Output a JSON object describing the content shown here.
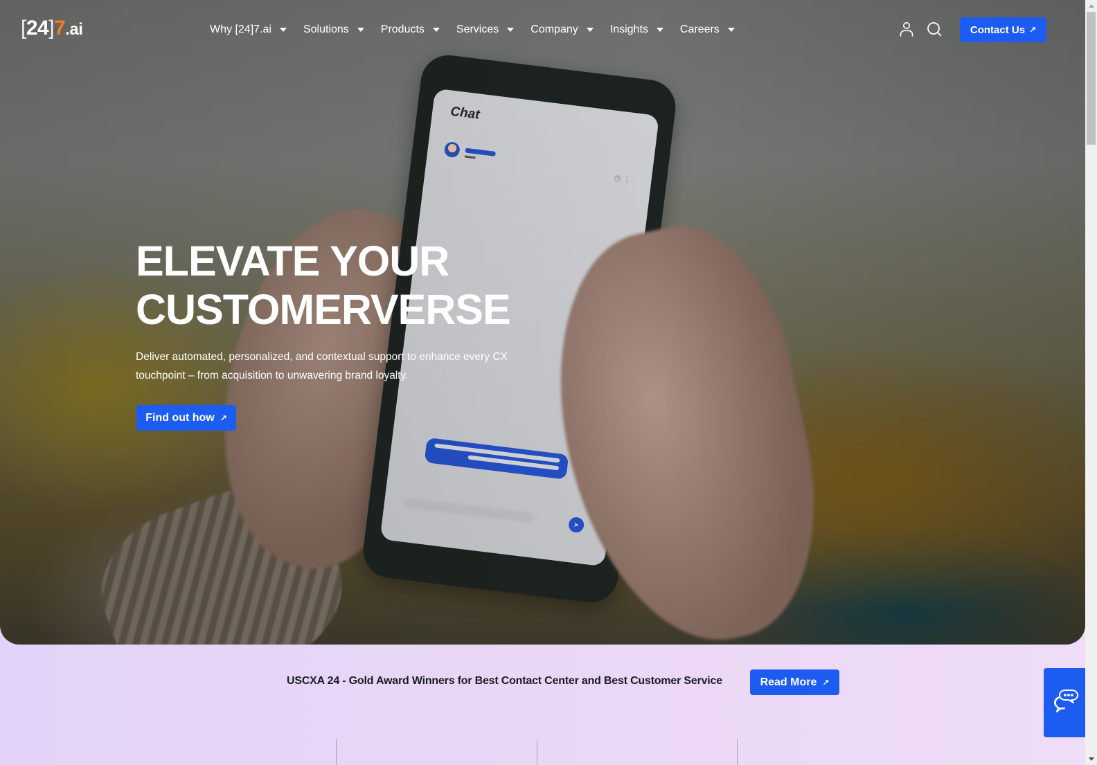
{
  "nav": {
    "logo": {
      "bracket_open": "[",
      "digits": "24",
      "bracket_close": "]",
      "seven": "7",
      "suffix": ".ai"
    },
    "menu": [
      {
        "label": "Why [24]7.ai"
      },
      {
        "label": "Solutions"
      },
      {
        "label": "Products"
      },
      {
        "label": "Services"
      },
      {
        "label": "Company"
      },
      {
        "label": "Insights"
      },
      {
        "label": "Careers"
      }
    ],
    "icons": {
      "account": "user-icon",
      "search": "search-icon"
    },
    "contact_label": "Contact Us",
    "arrow_glyph": "↗"
  },
  "hero": {
    "title_line1": "ELEVATE YOUR",
    "title_line2": "CUSTOMERVERSE",
    "subtitle_line1": "Deliver automated, personalized, and contextual support to enhance every CX",
    "subtitle_line2": "touchpoint – from acquisition to unwavering brand loyalty.",
    "cta_label": "Find out how",
    "phone": {
      "chat_title": "Chat",
      "menu_dots": "⋮",
      "timer_glyph": "◷",
      "send_glyph": "➤"
    }
  },
  "award": {
    "text": "USCXA 24 - Gold Award Winners for Best Contact Center and Best Customer Service",
    "cta_label": "Read More"
  },
  "chat_widget": {
    "icon": "chat-bubbles-icon"
  },
  "colors": {
    "accent": "#1d5cf0",
    "logo_orange": "#f47a20",
    "band_bg": "#e6d6f8",
    "text_dark": "#1a1a22"
  }
}
